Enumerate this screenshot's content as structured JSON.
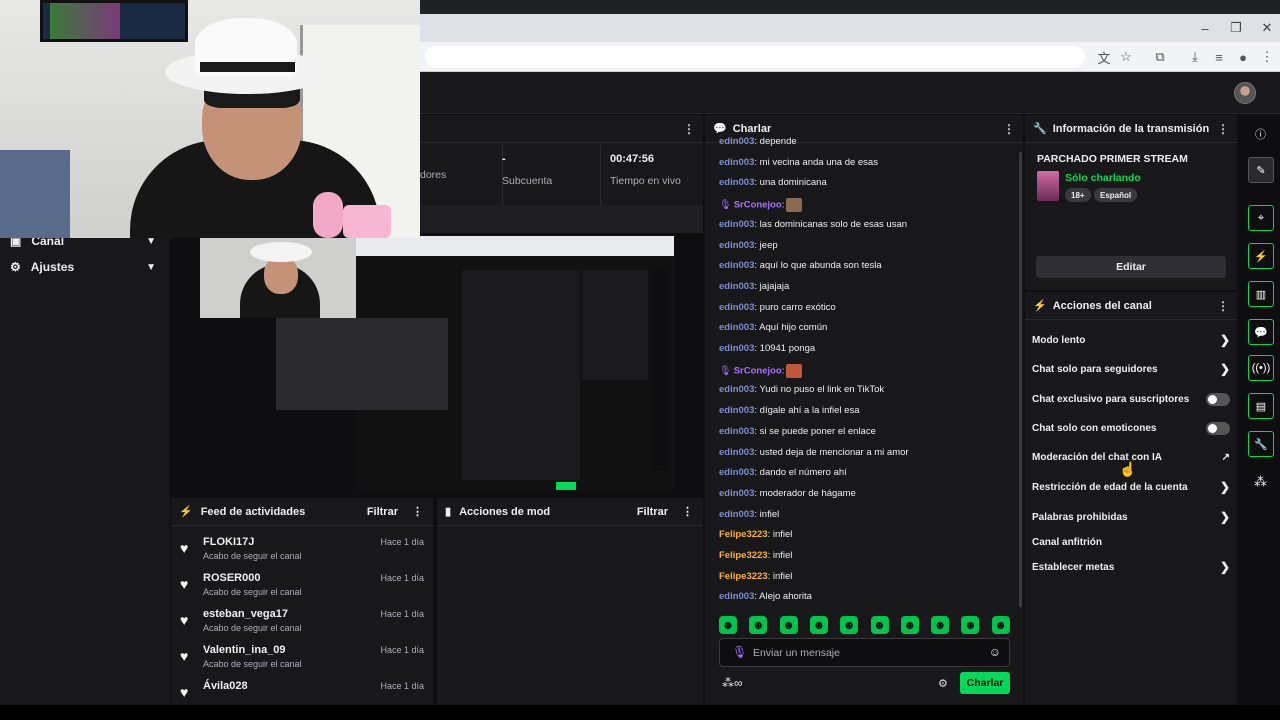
{
  "webcam": {
    "label": "webcam overlay"
  },
  "nav": {
    "items": [
      {
        "label": "Canal"
      },
      {
        "label": "Ajustes"
      }
    ]
  },
  "stats": {
    "followers_label": "dores",
    "sub_value": "-",
    "sub_label": "Subcuenta",
    "time_value": "00:47:56",
    "time_label": "Tiempo en vivo"
  },
  "feed": {
    "title": "Feed de actividades",
    "filter": "Filtrar",
    "items": [
      {
        "name": "FLOKI17J",
        "action": "Acabo de seguir el canal",
        "time": "Hace 1 día"
      },
      {
        "name": "ROSER000",
        "action": "Acabo de seguir el canal",
        "time": "Hace 1 día"
      },
      {
        "name": "esteban_vega17",
        "action": "Acabo de seguir el canal",
        "time": "Hace 1 día"
      },
      {
        "name": "Valentin_ina_09",
        "action": "Acabo de seguir el canal",
        "time": "Hace 1 día"
      },
      {
        "name": "Ávila028",
        "action": "",
        "time": "Hace 1 día"
      }
    ]
  },
  "mod_actions": {
    "title": "Acciones de mod",
    "filter": "Filtrar"
  },
  "chat": {
    "title": "Charlar",
    "messages": [
      {
        "user": "edin003",
        "text": ": depende"
      },
      {
        "user": "edin003",
        "text": ": mi vecina anda una de esas"
      },
      {
        "user": "edin003",
        "text": ": una dominicana"
      },
      {
        "user": "SrConejoo",
        "text": ":"
      },
      {
        "user": "edin003",
        "text": ": las dominicanas solo de esas usan"
      },
      {
        "user": "edin003",
        "text": ": jeep"
      },
      {
        "user": "edin003",
        "text": ": aquí lo que abunda son tesla"
      },
      {
        "user": "edin003",
        "text": ": jajajaja"
      },
      {
        "user": "edin003",
        "text": ": puro carro exótico"
      },
      {
        "user": "edin003",
        "text": ": Aquí hijo común"
      },
      {
        "user": "edin003",
        "text": ": 10941 ponga"
      },
      {
        "user": "SrConejoo",
        "text": ":"
      },
      {
        "user": "edin003",
        "text": ": Yudi no puso el link en TikTok"
      },
      {
        "user": "edin003",
        "text": ": dígale ahí a la infiel esa"
      },
      {
        "user": "edin003",
        "text": ": si se puede poner el enlace"
      },
      {
        "user": "edin003",
        "text": ": usted deja de mencionar a mi amor"
      },
      {
        "user": "edin003",
        "text": ": dando el número ahí"
      },
      {
        "user": "edin003",
        "text": ": moderador de hágame"
      },
      {
        "user": "edin003",
        "text": ": infiel"
      },
      {
        "user": "Felipe3223",
        "text": ": infiel"
      },
      {
        "user": "Felipe3223",
        "text": ": infiel"
      },
      {
        "user": "Felipe3223",
        "text": ": infiel"
      },
      {
        "user": "edin003",
        "text": ": Alejo ahorita"
      }
    ],
    "input_placeholder": "Enviar un mensaje",
    "send_label": "Charlar"
  },
  "info": {
    "title": "Información de la transmisión",
    "stream_title": "PARCHADO PRIMER STREAM",
    "category": "Sólo charlando",
    "badges": [
      "18+",
      "Español"
    ],
    "edit_label": "Editar"
  },
  "channel_actions": {
    "title": "Acciones del canal",
    "items": [
      {
        "label": "Modo lento"
      },
      {
        "label": "Chat solo para seguidores"
      },
      {
        "label": "Chat exclusivo para suscriptores"
      },
      {
        "label": "Chat solo con emoticones"
      },
      {
        "label": "Moderación del chat con IA"
      },
      {
        "label": "Restricción de edad de la cuenta"
      },
      {
        "label": "Palabras prohibidas"
      },
      {
        "label": "Canal anfitrión"
      },
      {
        "label": "Establecer metas"
      }
    ]
  },
  "colors": {
    "accent": "#00d95a",
    "user_blue": "#7b8fd1",
    "user_purple": "#a970ff",
    "user_gold": "#ffb31a"
  }
}
